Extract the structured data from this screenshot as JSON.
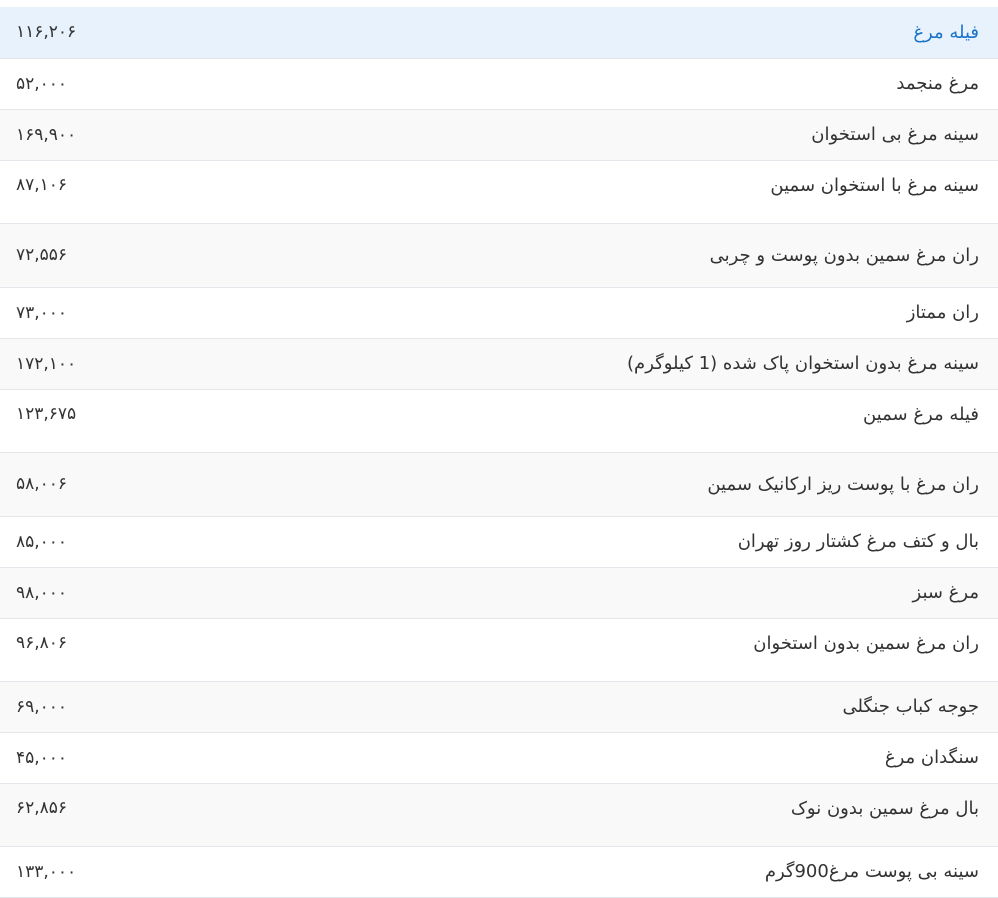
{
  "colors": {
    "link": "#1a73c9",
    "highlight_row": "#e8f2fc",
    "alt_row": "#f9f9f9",
    "divider": "#e3e6ea",
    "text": "#333333"
  },
  "rows": [
    {
      "name": "فیله مرغ",
      "price": "۱۱۶,۲۰۶"
    },
    {
      "name": "مرغ منجمد",
      "price": "۵۲,۰۰۰"
    },
    {
      "name": "سینه مرغ بی استخوان",
      "price": "۱۶۹,۹۰۰"
    },
    {
      "name": "سینه مرغ با استخوان سمین",
      "price": "۸۷,۱۰۶"
    },
    {
      "name": "ران مرغ سمین بدون پوست و چربی",
      "price": "۷۲,۵۵۶"
    },
    {
      "name": "ران ممتاز",
      "price": "۷۳,۰۰۰"
    },
    {
      "name": "سینه مرغ بدون استخوان پاک شده (1 کیلوگرم)",
      "price": "۱۷۲,۱۰۰"
    },
    {
      "name": "فیله مرغ سمین",
      "price": "۱۲۳,۶۷۵"
    },
    {
      "name": "ران مرغ با پوست ریز ارکانیک سمین",
      "price": "۵۸,۰۰۶"
    },
    {
      "name": "بال و کتف مرغ کشتار روز تهران",
      "price": "۸۵,۰۰۰"
    },
    {
      "name": "مرغ سبز",
      "price": "۹۸,۰۰۰"
    },
    {
      "name": "ران مرغ سمین بدون استخوان",
      "price": "۹۶,۸۰۶"
    },
    {
      "name": "جوجه کباب جنگلی",
      "price": "۶۹,۰۰۰"
    },
    {
      "name": "سنگدان مرغ",
      "price": "۴۵,۰۰۰"
    },
    {
      "name": "بال مرغ سمین بدون نوک",
      "price": "۶۲,۸۵۶"
    },
    {
      "name": "سینه بی پوست مرغ900گرم",
      "price": "۱۳۳,۰۰۰"
    }
  ]
}
